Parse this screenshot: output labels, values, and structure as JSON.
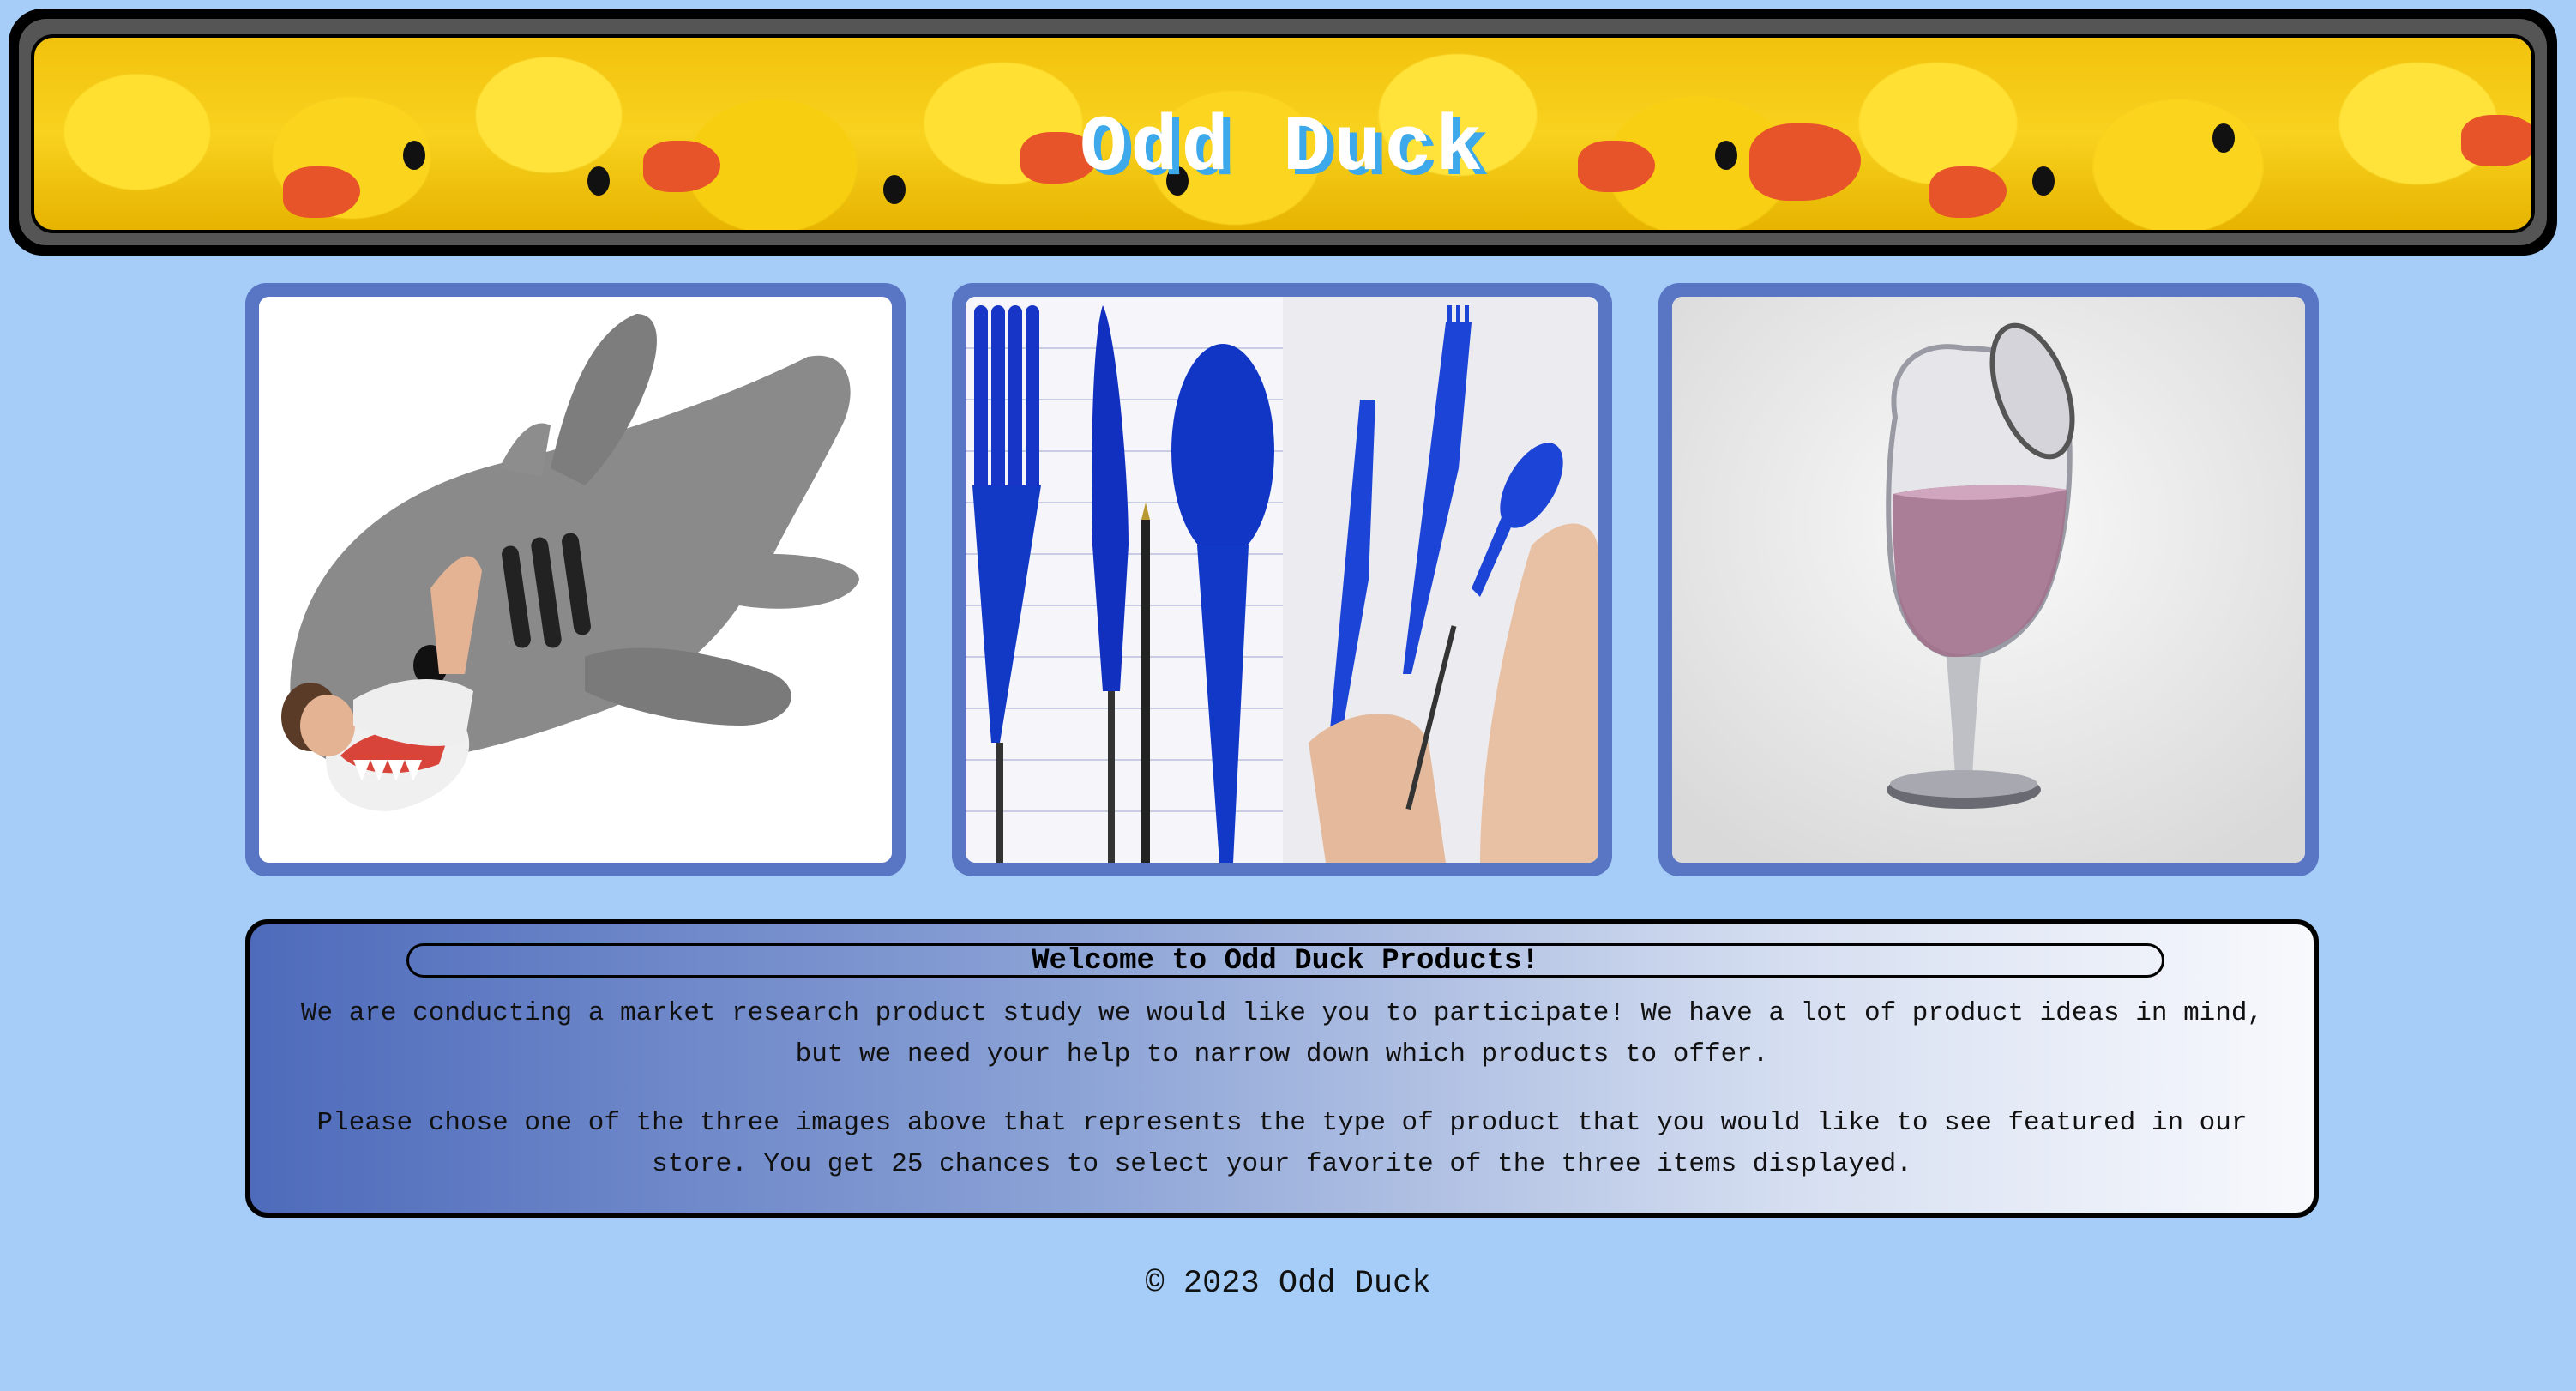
{
  "header": {
    "title": "Odd Duck"
  },
  "products": [
    {
      "name": "shark sleeping bag"
    },
    {
      "name": "pen utensils"
    },
    {
      "name": "wine glass"
    }
  ],
  "welcome": {
    "heading": "Welcome to Odd Duck Products!",
    "paragraphs": [
      "We are conducting a market research product study we would like you to participate! We have a lot of product ideas in mind, but we need your help to narrow down which products to offer.",
      "Please chose one of the three images above that represents the type of product that you would like to see featured in our store. You get 25 chances to select your favorite of the three items displayed."
    ]
  },
  "footer": {
    "text": "© 2023 Odd Duck"
  },
  "colors": {
    "page_background": "#a6cdf8",
    "card_border": "#5876c4",
    "title_shadow": "#3da8ea"
  }
}
